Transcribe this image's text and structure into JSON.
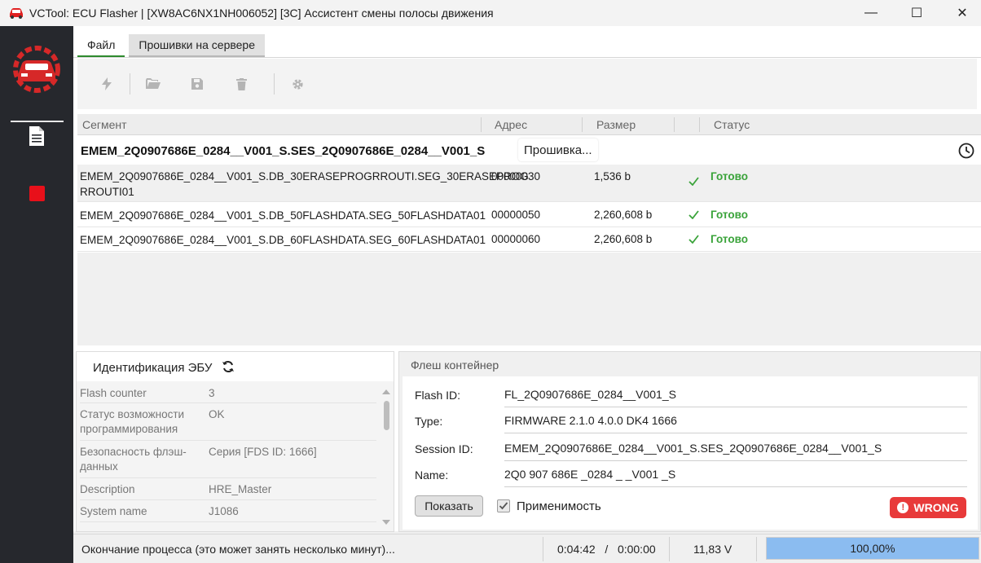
{
  "window": {
    "title": "VCTool: ECU Flasher | [XW8AC6NX1NH006052] [3C] Ассистент смены полосы движения",
    "minimize": "—",
    "maximize": "☐",
    "close": "✕"
  },
  "tabs": [
    {
      "label": "Файл",
      "active": true
    },
    {
      "label": "Прошивки на сервере",
      "active": false
    }
  ],
  "table": {
    "headers": {
      "segment": "Сегмент",
      "address": "Адрес",
      "size": "Размер",
      "status": "Статус"
    },
    "group": {
      "title": "EMEM_2Q0907686E_0284__V001_S.SES_2Q0907686E_0284__V001_S",
      "status": "Прошивка..."
    },
    "rows": [
      {
        "name_line1": "EMEM_2Q0907686E_0284__V001_S.DB_30ERASEPROGRROUTI.SEG_30ERASEPROG",
        "name_line2": "RROUTI01",
        "address": "00000030",
        "size": "1,536 b",
        "status": "Готово"
      },
      {
        "name_line1": "EMEM_2Q0907686E_0284__V001_S.DB_50FLASHDATA.SEG_50FLASHDATA01",
        "name_line2": "",
        "address": "00000050",
        "size": "2,260,608 b",
        "status": "Готово"
      },
      {
        "name_line1": "EMEM_2Q0907686E_0284__V001_S.DB_60FLASHDATA.SEG_60FLASHDATA01",
        "name_line2": "",
        "address": "00000060",
        "size": "2,260,608 b",
        "status": "Готово"
      }
    ]
  },
  "ecu": {
    "title": "Идентификация ЭБУ",
    "items": [
      {
        "key_line1": "Flash counter",
        "key_line2": "",
        "value": "3"
      },
      {
        "key_line1": "Статус возможности",
        "key_line2": "программирования",
        "value": "OK"
      },
      {
        "key_line1": "Безопасность флэш-",
        "key_line2": "данных",
        "value": "Серия [FDS ID: 1666]"
      },
      {
        "key_line1": "Description",
        "key_line2": "",
        "value": "HRE_Master"
      },
      {
        "key_line1": "System name",
        "key_line2": "",
        "value": "J1086"
      }
    ]
  },
  "flash": {
    "title": "Флеш контейнер",
    "fields": [
      {
        "label": "Flash ID:",
        "value": "FL_2Q0907686E_0284__V001_S"
      },
      {
        "label": "Type:",
        "value": "FIRMWARE 2.1.0 4.0.0 DK4 1666"
      },
      {
        "label": "Session ID:",
        "value": "EMEM_2Q0907686E_0284__V001_S.SES_2Q0907686E_0284__V001_S"
      },
      {
        "label": "Name:",
        "value": "2Q0 907 686E _0284 _ _V001 _S"
      }
    ],
    "show_button": "Показать",
    "applicability_label": "Применимость",
    "applicability_checked": true,
    "badge": "WRONG"
  },
  "status_bar": {
    "message": "Окончание процесса (это может занять несколько минут)...",
    "time": "0:04:42   /   0:00:00",
    "voltage": "11,83 V",
    "progress_text": "100,00%",
    "progress_value": 100
  },
  "colors": {
    "accent_green": "#2e8b2e",
    "status_green": "#3aa33a",
    "wrong_red": "#e83a3a",
    "progress_blue": "#8bbcf0",
    "sidebar_bg": "#26282d"
  }
}
